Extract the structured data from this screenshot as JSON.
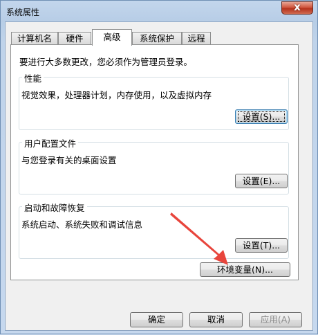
{
  "window": {
    "title": "系统属性",
    "close_glyph": "x"
  },
  "tabs": [
    "计算机名",
    "硬件",
    "高级",
    "系统保护",
    "远程"
  ],
  "active_tab_index": 2,
  "notice": "要进行大多数更改，您必须作为管理员登录。",
  "groups": {
    "performance": {
      "title": "性能",
      "desc": "视觉效果，处理器计划，内存使用，以及虚拟内存",
      "button": "设置(S)..."
    },
    "user_profiles": {
      "title": "用户配置文件",
      "desc": "与您登录有关的桌面设置",
      "button": "设置(E)..."
    },
    "startup_recovery": {
      "title": "启动和故障恢复",
      "desc": "系统启动、系统失败和调试信息",
      "button": "设置(T)..."
    }
  },
  "env_button": "环境变量(N)...",
  "footer": {
    "ok": "确定",
    "cancel": "取消",
    "apply": "应用(A)"
  },
  "colors": {
    "arrow": "#e8453c",
    "close_button": "#c8442e"
  },
  "icons": {
    "arrow": "annotation-arrow",
    "close": "close-icon"
  }
}
